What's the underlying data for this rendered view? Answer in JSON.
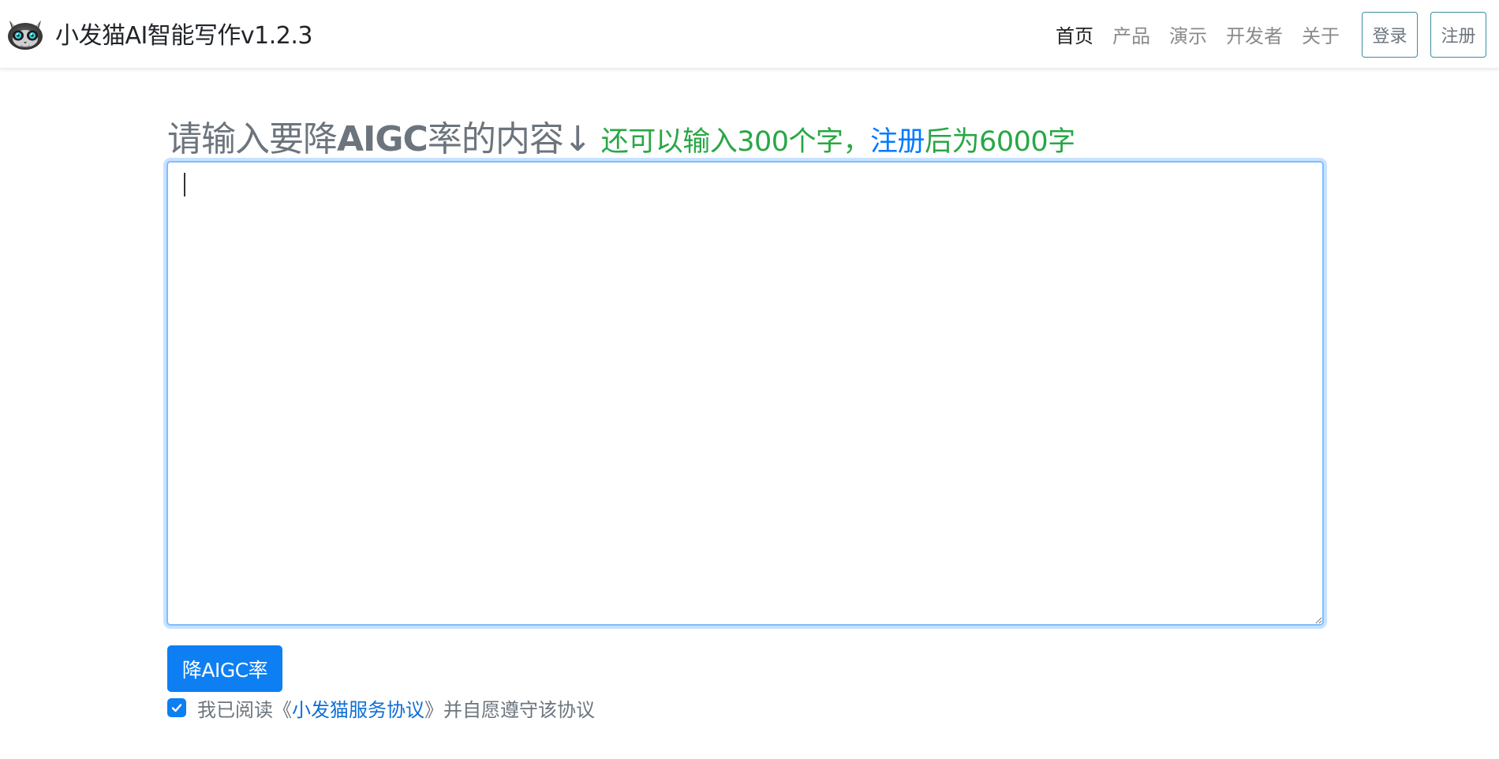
{
  "brand": {
    "name": "小发猫AI智能写作v1.2.3",
    "logo_icon": "cat-mascot-icon"
  },
  "nav": {
    "items": [
      {
        "label": "首页",
        "active": true
      },
      {
        "label": "产品",
        "active": false
      },
      {
        "label": "演示",
        "active": false
      },
      {
        "label": "开发者",
        "active": false
      },
      {
        "label": "关于",
        "active": false
      }
    ],
    "login_label": "登录",
    "register_label": "注册"
  },
  "main": {
    "heading_prefix": "请输入要降",
    "heading_bold": "AIGC",
    "heading_suffix": "率的内容↓",
    "hint_prefix": "还可以输入300个字，",
    "hint_link": "注册",
    "hint_suffix": "后为6000字",
    "content_value": "",
    "submit_label": "降AIGC率",
    "agreement": {
      "checked": true,
      "text_before": "我已阅读《",
      "link_text": "小发猫服务协议",
      "text_after": "》并自愿遵守该协议"
    }
  },
  "colors": {
    "primary": "#0d7ff3",
    "hint_green": "#28a745",
    "link_blue": "#007bff",
    "outline_teal": "#3a8fa0"
  }
}
